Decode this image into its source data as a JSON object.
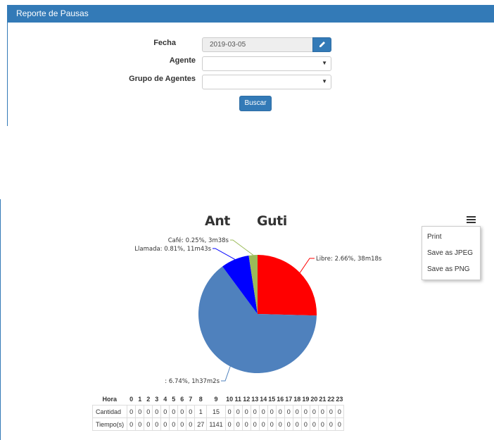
{
  "panel": {
    "title": "Reporte de Pausas"
  },
  "form": {
    "fecha_label": "Fecha",
    "fecha_value": "2019-03-05",
    "agente_label": "Agente",
    "grupo_label": "Grupo de Agentes",
    "buscar_label": "Buscar"
  },
  "chart": {
    "title_part1": "Ant",
    "title_part2": "Guti",
    "menu": {
      "print": "Print",
      "jpeg": "Save as JPEG",
      "png": "Save as PNG"
    }
  },
  "chart_data": {
    "type": "pie",
    "slices": [
      {
        "name": "Libre",
        "label": "Libre: 2.66%, 38m18s",
        "value": 2.66,
        "color": "#ff0000"
      },
      {
        "name": "",
        "label": ": 6.74%, 1h37m2s",
        "value": 6.74,
        "color": "#4f81bd"
      },
      {
        "name": "Llamada",
        "label": "Llamada: 0.81%, 11m43s",
        "value": 0.81,
        "color": "#0000ff"
      },
      {
        "name": "Café",
        "label": "Café: 0.25%, 3m38s",
        "value": 0.25,
        "color": "#9bbb59"
      }
    ]
  },
  "table": {
    "header_label": "Hora",
    "hours": [
      "0",
      "1",
      "2",
      "3",
      "4",
      "5",
      "6",
      "7",
      "8",
      "9",
      "10",
      "11",
      "12",
      "13",
      "14",
      "15",
      "16",
      "17",
      "18",
      "19",
      "20",
      "21",
      "22",
      "23"
    ],
    "rows": [
      {
        "label": "Cantidad",
        "values": [
          "0",
          "0",
          "0",
          "0",
          "0",
          "0",
          "0",
          "0",
          "1",
          "15",
          "0",
          "0",
          "0",
          "0",
          "0",
          "0",
          "0",
          "0",
          "0",
          "0",
          "0",
          "0",
          "0",
          "0"
        ]
      },
      {
        "label": "Tiempo(s)",
        "values": [
          "0",
          "0",
          "0",
          "0",
          "0",
          "0",
          "0",
          "0",
          "27",
          "1141",
          "0",
          "0",
          "0",
          "0",
          "0",
          "0",
          "0",
          "0",
          "0",
          "0",
          "0",
          "0",
          "0",
          "0"
        ]
      }
    ]
  }
}
